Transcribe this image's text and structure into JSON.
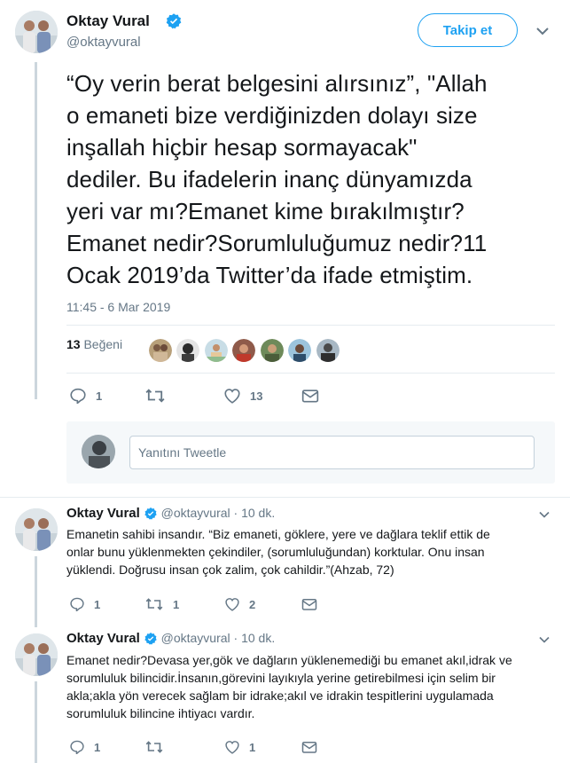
{
  "main_tweet": {
    "author_name": "Oktay Vural",
    "author_handle": "@oktayvural",
    "follow_label": "Takip et",
    "text_lines": [
      "“Oy verin berat belgesini alırsınız”, \"Allah",
      "o emaneti bize verdiğinizden dolayı size",
      "inşallah hiçbir hesap sormayacak\"",
      "dediler. Bu ifadelerin inanç dünyamızda",
      "yeri var mı?Emanet kime bırakılmıştır?",
      "Emanet nedir?Sorumluluğumuz nedir?11",
      "Ocak 2019’da Twitter’da ifade etmiştim."
    ],
    "timestamp": "11:45 - 6 Mar 2019",
    "likes_count": "13",
    "likes_label": "Beğeni",
    "reply_count": "1",
    "retweet_count": "",
    "like_count": "13"
  },
  "reply_box": {
    "placeholder": "Yanıtını Tweetle"
  },
  "replies": [
    {
      "author_name": "Oktay Vural",
      "author_handle": "@oktayvural",
      "time": "· 10 dk.",
      "text_lines": [
        "Emanetin sahibi insandır. “Biz emaneti, göklere, yere ve dağlara teklif ettik de",
        "onlar bunu yüklenmekten çekindiler, (sorumluluğundan) korktular. Onu insan",
        "yüklendi. Doğrusu insan çok zalim, çok cahildir.”(Ahzab, 72)"
      ],
      "reply_count": "1",
      "retweet_count": "1",
      "like_count": "2"
    },
    {
      "author_name": "Oktay Vural",
      "author_handle": "@oktayvural",
      "time": "· 10 dk.",
      "text_lines": [
        "Emanet nedir?Devasa yer,gök ve dağların yüklenemediği bu emanet akıl,idrak ve",
        "sorumluluk bilincidir.İnsanın,görevini layıkıyla yerine getirebilmesi için selim bir",
        "akla;akla yön verecek sağlam bir idrake;akıl ve idrakin tespitlerini uygulamada",
        "sorumluluk bilincine ihtiyacı vardır."
      ],
      "reply_count": "1",
      "retweet_count": "",
      "like_count": "1"
    }
  ],
  "icons": {
    "verified": "verified-badge-icon",
    "reply": "reply-icon",
    "retweet": "retweet-icon",
    "like": "heart-icon",
    "dm": "direct-message-icon",
    "caret": "chevron-down-icon"
  },
  "colors": {
    "accent": "#1da1f2",
    "muted": "#657786",
    "text": "#14171a"
  }
}
